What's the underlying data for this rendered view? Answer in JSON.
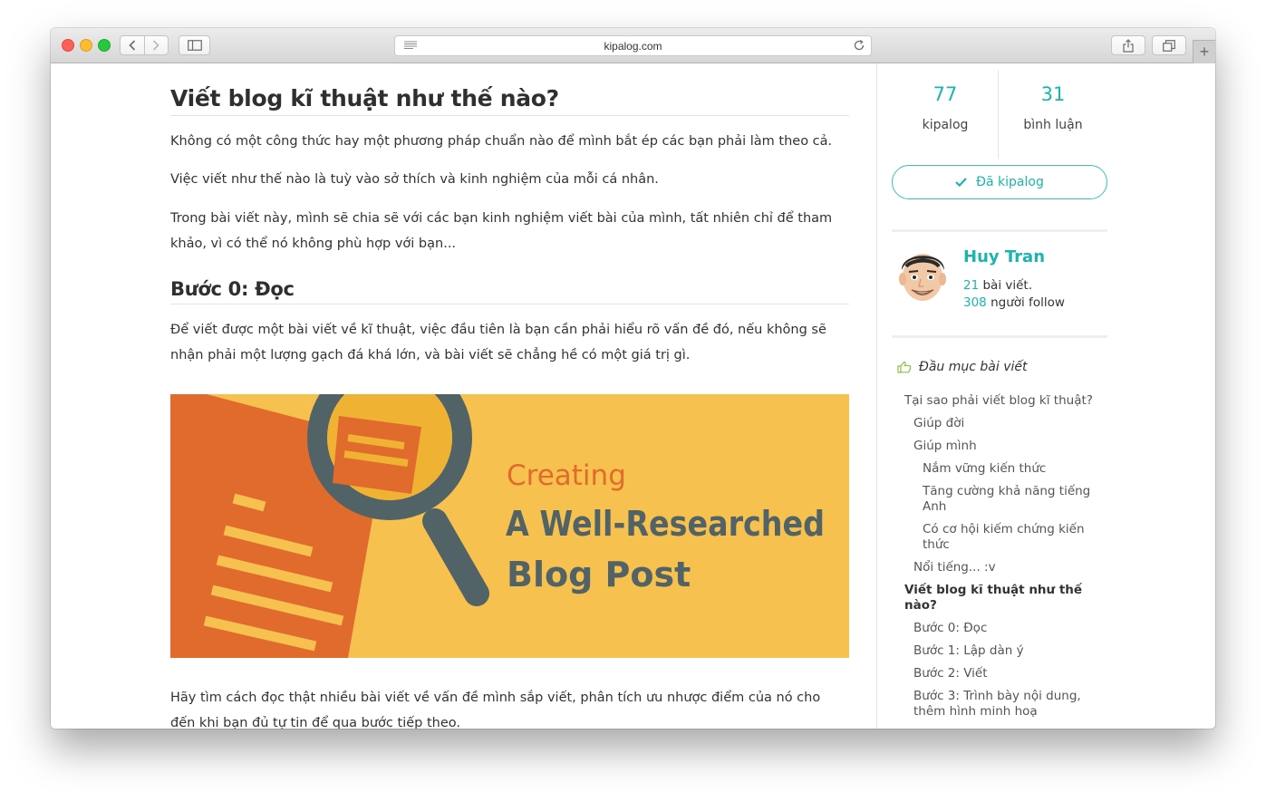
{
  "browser": {
    "url": "kipalog.com"
  },
  "article": {
    "title": "Viết blog kĩ thuật như thế nào?",
    "paragraphs": [
      "Không có một công thức hay một phương pháp chuẩn nào để mình bắt ép các bạn phải làm theo cả.",
      "Việc viết như thế nào là tuỳ vào sở thích và kinh nghiệm của mỗi cá nhân.",
      "Trong bài viết này, mình sẽ chia sẽ với các bạn kinh nghiệm viết bài của mình, tất nhiên chỉ để tham khảo, vì có thể nó không phù hợp với bạn..."
    ],
    "section_title": "Bước 0: Đọc",
    "section_paragraph": "Để viết được một bài viết về kĩ thuật, việc đầu tiên là bạn cần phải hiểu rõ vấn đề đó, nếu không sẽ nhận phải một lượng gạch đá khá lớn, và bài viết sẽ chẳng hề có một giá trị gì.",
    "image": {
      "line1": "Creating",
      "line2": "A Well-Researched",
      "line3": "Blog Post",
      "background_color": "#f6c14f",
      "accent_color": "#e06b2c",
      "dark_color": "#516366"
    },
    "after_image_paragraph": "Hãy tìm cách đọc thật nhiều bài viết về vấn đề mình sắp viết, phân tích ưu nhược điểm của nó cho đến khi bạn đủ tự tin để qua bước tiếp theo."
  },
  "sidebar": {
    "stats": [
      {
        "value": "77",
        "label": "kipalog"
      },
      {
        "value": "31",
        "label": "bình luận"
      }
    ],
    "kipalog_button": "Đã kipalog",
    "author": {
      "name": "Huy Tran",
      "posts_count": "21",
      "posts_suffix": "bài viết.",
      "followers_count": "308",
      "followers_suffix": "người follow"
    },
    "toc_title": "Đầu mục bài viết",
    "toc": [
      {
        "label": "Tại sao phải viết blog kĩ thuật?",
        "level": 1
      },
      {
        "label": "Giúp đời",
        "level": 2
      },
      {
        "label": "Giúp mình",
        "level": 2
      },
      {
        "label": "Nắm vững kiến thức",
        "level": 3
      },
      {
        "label": "Tăng cường khả năng tiếng Anh",
        "level": 3
      },
      {
        "label": "Có cơ hội kiếm chứng kiến thức",
        "level": 3
      },
      {
        "label": "Nổi tiếng... :v",
        "level": 2
      },
      {
        "label": "Viết blog kĩ thuật như thế nào?",
        "level": 1,
        "active": true
      },
      {
        "label": "Bước 0: Đọc",
        "level": 2
      },
      {
        "label": "Bước 1: Lập dàn ý",
        "level": 2
      },
      {
        "label": "Bước 2: Viết",
        "level": 2
      },
      {
        "label": "Bước 3: Trình bày nội dung, thêm hình minh hoạ",
        "level": 2
      }
    ],
    "accent_color": "#1ab5ae"
  }
}
